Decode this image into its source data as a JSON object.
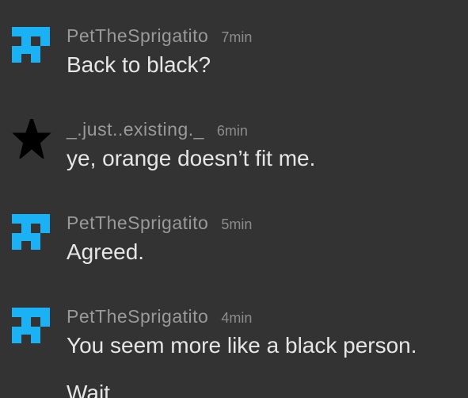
{
  "messages": [
    {
      "user": "PetTheSprigatito",
      "time": "7min",
      "text": "Back to black?",
      "avatar": "pixel-logo-icon"
    },
    {
      "user": "_.just..existing._",
      "time": "6min",
      "text": "ye, orange doesn’t fit me.",
      "avatar": "star-icon"
    },
    {
      "user": "PetTheSprigatito",
      "time": "5min",
      "text": "Agreed.",
      "avatar": "pixel-logo-icon"
    },
    {
      "user": "PetTheSprigatito",
      "time": "4min",
      "text": "You seem more like a black person.",
      "avatar": "pixel-logo-icon"
    },
    {
      "user": "",
      "time": "",
      "text": "Wait",
      "avatar": ""
    }
  ],
  "colors": {
    "background": "#333333",
    "avatar_blue": "#1ab2f5",
    "username": "#9a9a9a",
    "message_text": "#e6e6e6"
  }
}
